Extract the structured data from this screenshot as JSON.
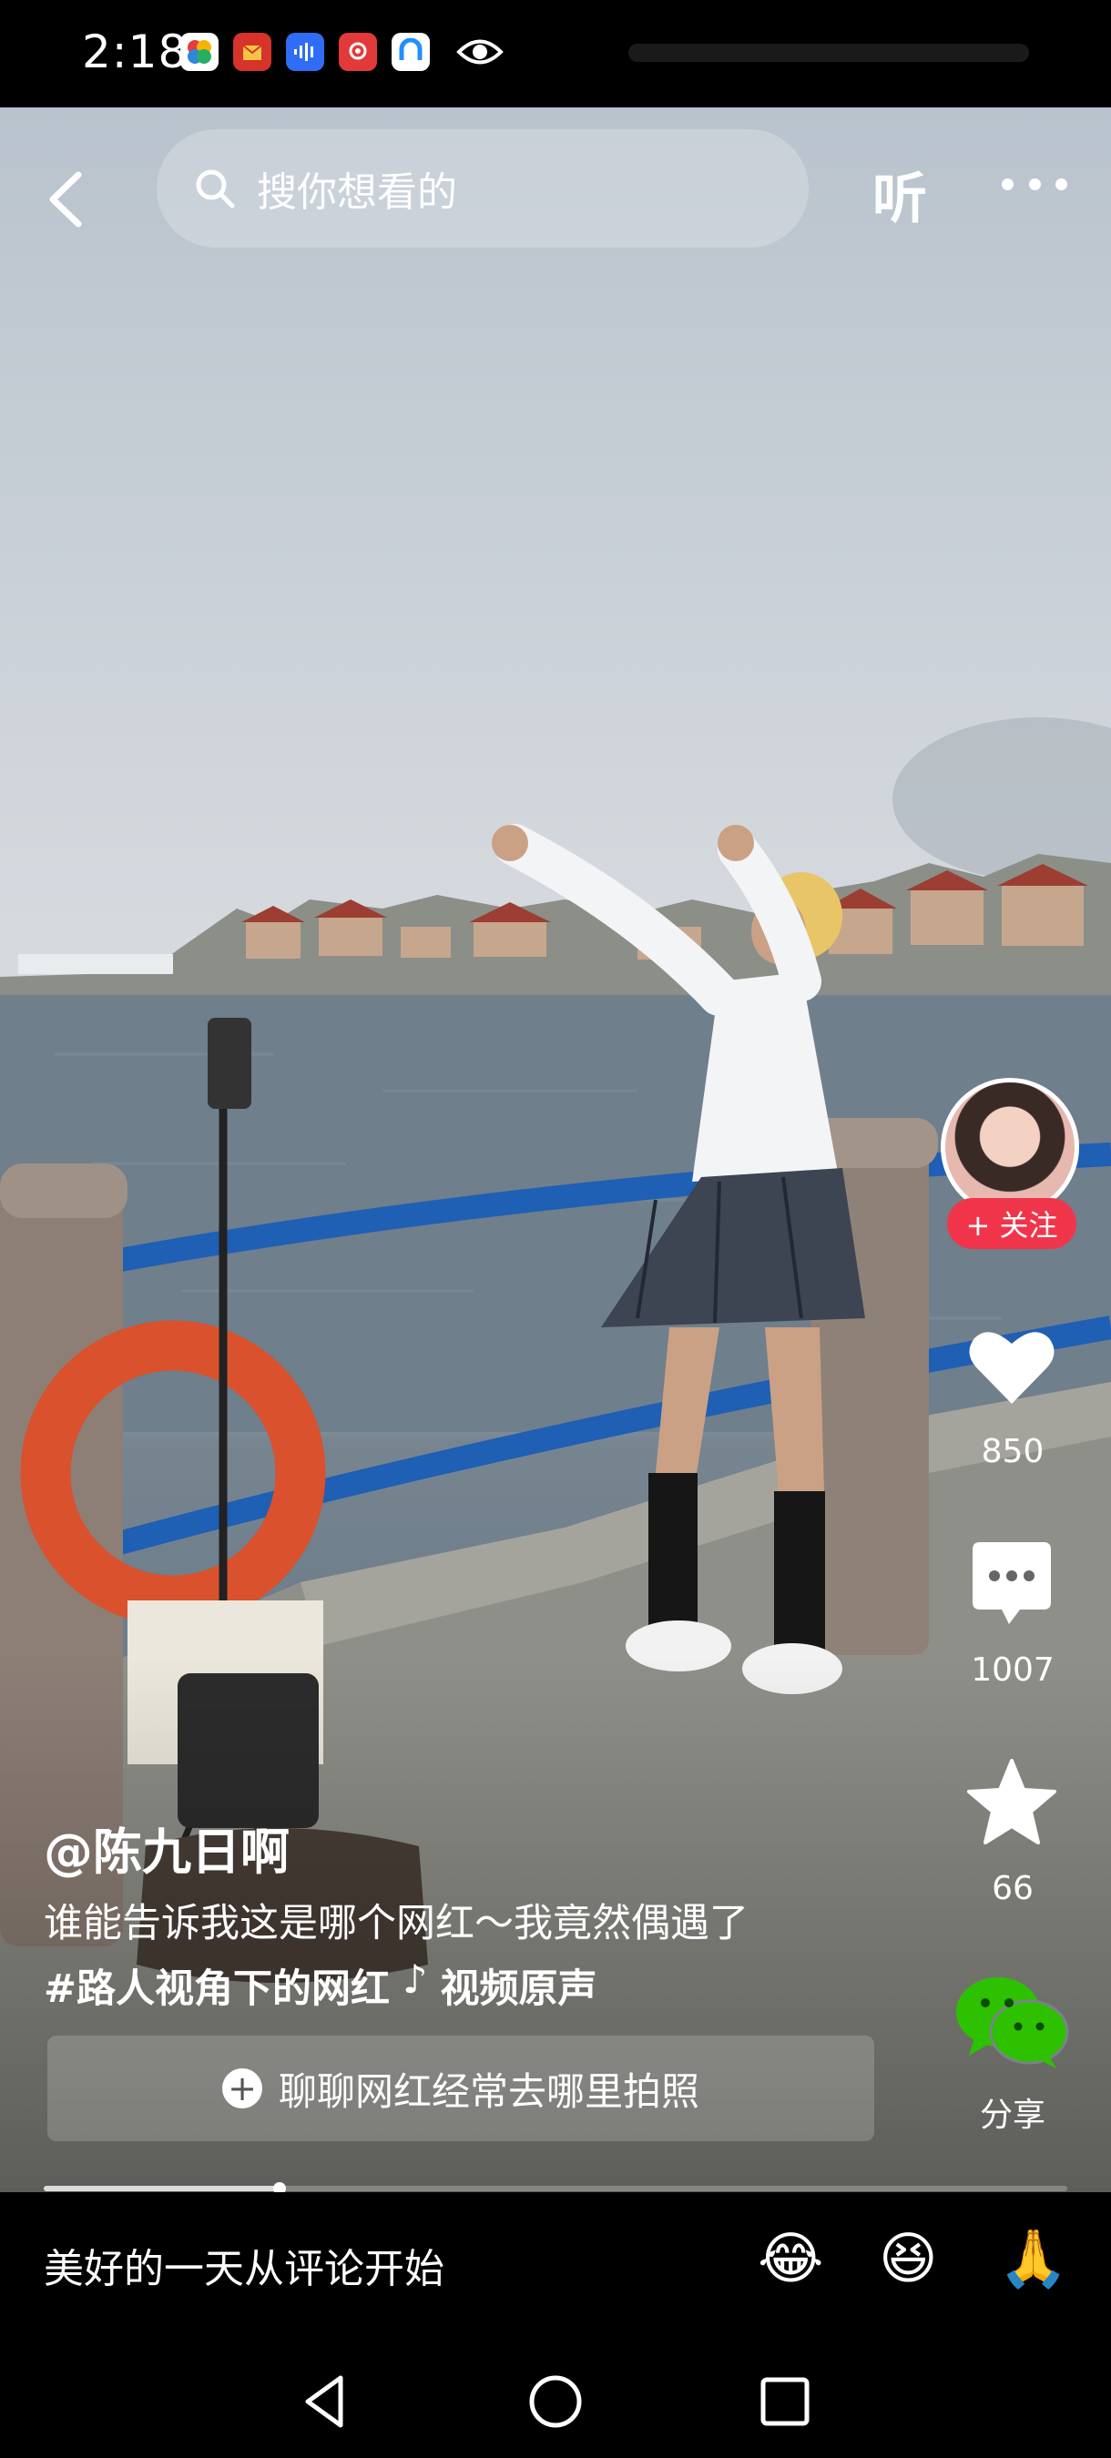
{
  "status_bar": {
    "time": "2:18"
  },
  "top_bar": {
    "search_placeholder": "搜你想看的",
    "listen_label": "听"
  },
  "author": {
    "handle": "@陈九日啊",
    "follow_label": "+ 关注"
  },
  "caption": {
    "description": "谁能告诉我这是哪个网红～我竟然偶遇了",
    "hashtag": "#路人视角下的网红",
    "music_icon": "♪",
    "sound": "视频原声"
  },
  "chat_suggestion": {
    "label": "聊聊网红经常去哪里拍照"
  },
  "actions": {
    "like_count": "850",
    "comment_count": "1007",
    "favorite_count": "66",
    "share_label": "分享"
  },
  "playback": {
    "progress_fraction": 0.23
  },
  "comment_bar": {
    "placeholder": "美好的一天从评论开始",
    "emojis": [
      "😂",
      "😆",
      "🙏"
    ]
  },
  "colors": {
    "follow_red": "#f0354a",
    "wechat_green": "#2dc100"
  }
}
